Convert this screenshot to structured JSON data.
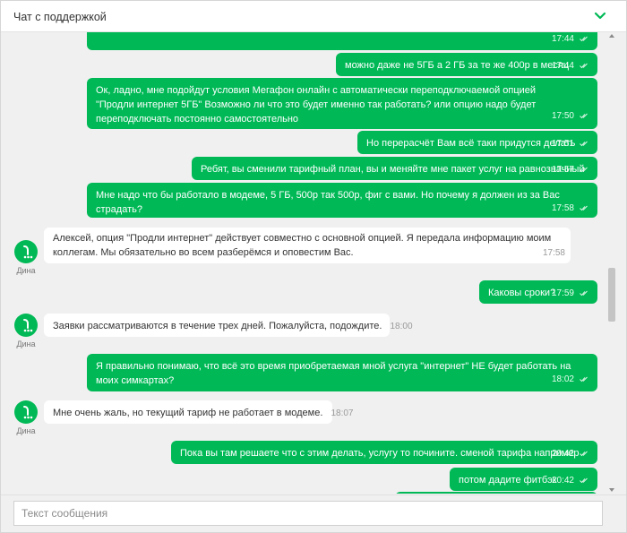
{
  "header": {
    "title": "Чат с поддержкой"
  },
  "agent": {
    "name": "Дина"
  },
  "messages": [
    {
      "side": "out",
      "text": "",
      "time": "17:44"
    },
    {
      "side": "out",
      "text": "можно даже не 5ГБ а 2 ГБ за те же 400р в месяц",
      "time": "17:44"
    },
    {
      "side": "out",
      "text": "Ок, ладно, мне подойдут условия Мегафон онлайн с автоматически переподключаемой опцией \"Продли интернет 5ГБ\" Возможно ли что это будет именно так работать? или опцию надо будет переподключать постоянно самостоятельно",
      "time": "17:50"
    },
    {
      "side": "out",
      "text": "Но перерасчёт Вам всё таки придутся делать",
      "time": "17:51"
    },
    {
      "side": "out",
      "text": "Ребят, вы сменили тарифный план, вы и меняйте мне пакет услуг на равнозначный",
      "time": "17:57"
    },
    {
      "side": "out",
      "text": "Мне надо что бы работало в модеме, 5 ГБ, 500р так 500р, фиг с вами. Но почему я должен из за Вас страдать?",
      "time": "17:58"
    },
    {
      "side": "in",
      "text": "Алексей, опция \"Продли интернет\" действует совместно с основной опцией. Я передала информацию моим коллегам. Мы обязательно во всем разберёмся и оповестим Вас.",
      "time": "17:58"
    },
    {
      "side": "out",
      "text": "Каковы сроки?",
      "time": "17:59"
    },
    {
      "side": "in",
      "text": "Заявки рассматриваются в течение трех дней. Пожалуйста, подождите.",
      "time": "18:00"
    },
    {
      "side": "out",
      "text": "Я правильно понимаю, что всё это время приобретаемая мной услуга \"интернет\" НЕ будет работать на моих симкартах?",
      "time": "18:02"
    },
    {
      "side": "in",
      "text": "Мне очень жаль, но текущий тариф не работает в модеме.",
      "time": "18:07"
    },
    {
      "side": "out",
      "text": "Пока вы там решаете что с этим делать, услугу то почините. сменой тарифа например",
      "time": "20:42"
    },
    {
      "side": "out",
      "text": "потом дадите фитбэк",
      "time": "20:42"
    },
    {
      "side": "out",
      "text": "",
      "time": ""
    }
  ],
  "composer": {
    "placeholder": "Текст сообщения"
  },
  "colors": {
    "accent": "#00b956",
    "background": "#f0f0f0",
    "incoming": "#ffffff"
  },
  "icons": {
    "collapse": "chevron-down-icon",
    "read": "double-check-icon",
    "avatar": "megafon-logo-icon"
  }
}
